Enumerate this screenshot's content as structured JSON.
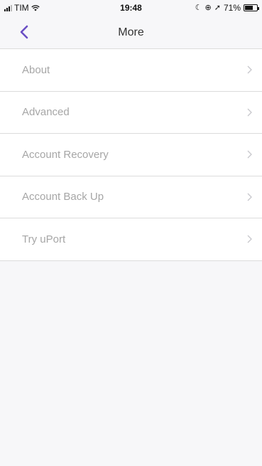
{
  "status_bar": {
    "carrier": "TIM",
    "time": "19:48",
    "battery": "71%",
    "battery_level": 0.71
  },
  "nav": {
    "title": "More",
    "back_icon": "chevron-left-icon",
    "accent_color": "#6a4fc4"
  },
  "menu": {
    "items": [
      {
        "label": "About"
      },
      {
        "label": "Advanced"
      },
      {
        "label": "Account Recovery"
      },
      {
        "label": "Account Back Up"
      },
      {
        "label": "Try uPort"
      }
    ],
    "chevron_icon": "chevron-right-icon"
  }
}
